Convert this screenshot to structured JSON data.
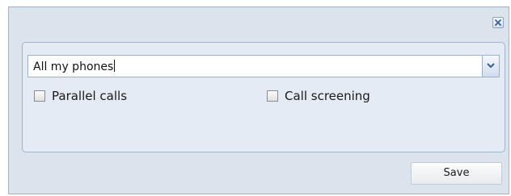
{
  "dialog": {
    "close_icon": "close-x-icon"
  },
  "forwarding": {
    "combo_value": "All my phones",
    "combo_trigger_icon": "chevron-down-icon",
    "options": [
      {
        "label": "Parallel calls",
        "checked": false
      },
      {
        "label": "Call screening",
        "checked": false
      }
    ]
  },
  "footer": {
    "save_label": "Save"
  },
  "colors": {
    "dialog_bg": "#dbe3ed",
    "panel_bg": "#e4ebf4",
    "panel_border": "#9fb4cf",
    "accent_icon": "#3a5f95"
  }
}
